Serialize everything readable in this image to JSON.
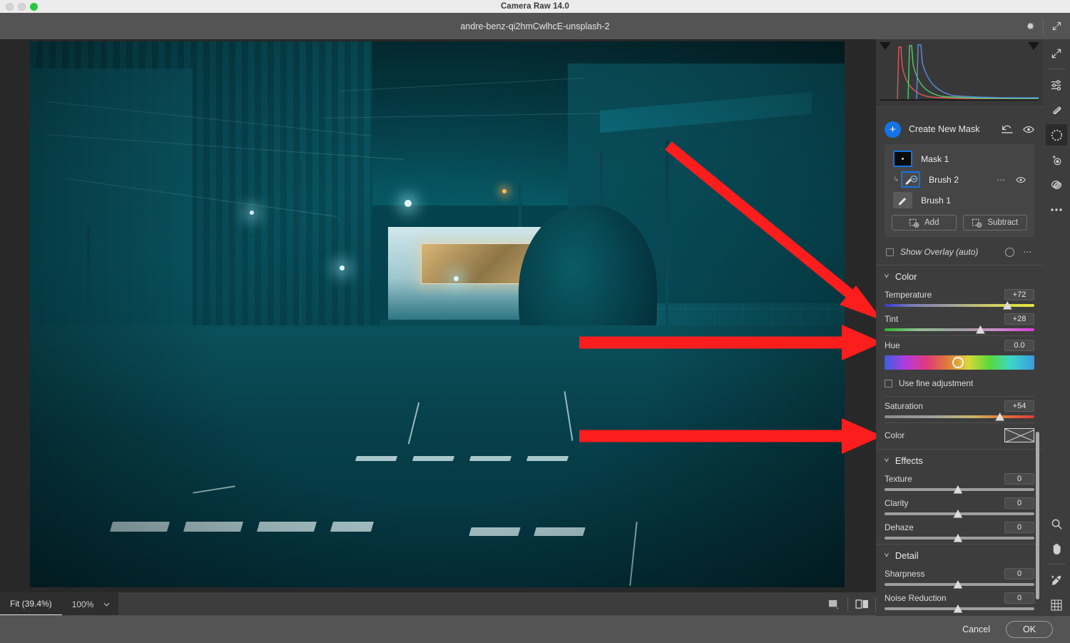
{
  "window": {
    "app_title": "Camera Raw 14.0",
    "file_name": "andre-benz-qi2hmCwlhcE-unsplash-2",
    "traffic_lights": [
      "close-disabled",
      "minimize-disabled",
      "zoom-green"
    ]
  },
  "header": {
    "settings_icon": "gear-icon",
    "fullscreen_icon": "expand-arrows-icon"
  },
  "canvas": {
    "image_alt": "night street scene in Tokyo with crosswalk, teal color grade",
    "annotations": [
      {
        "name": "arrow-to-temperature",
        "type": "diagonal-arrow",
        "color": "#fc1d1d"
      },
      {
        "name": "arrow-to-tint",
        "type": "horizontal-arrow",
        "color": "#fc1d1d"
      },
      {
        "name": "arrow-to-saturation",
        "type": "horizontal-arrow",
        "color": "#fc1d1d"
      }
    ]
  },
  "bottom_bar": {
    "fit_label": "Fit (39.4%)",
    "zoom_label": "100%",
    "caret_icon": "chevron-down-icon",
    "toggle_icon": "before-after-single-icon",
    "compare_icon": "before-after-split-icon"
  },
  "footer": {
    "cancel_label": "Cancel",
    "ok_label": "OK"
  },
  "right_panel": {
    "histogram": {
      "name": "histogram",
      "shadow_clip_icon": "shadow-clipping-triangle",
      "highlight_clip_icon": "highlight-clipping-triangle",
      "channels": [
        "red",
        "green",
        "blue"
      ]
    },
    "masking": {
      "create_new_mask_label": "Create New Mask",
      "plus_icon": "plus-icon",
      "reset_icon": "reset-arrow-icon",
      "visibility_icon": "eye-icon",
      "accent_color": "#1473e6",
      "masks": [
        {
          "name": "Mask 1",
          "thumb": "mask-thumbnail",
          "selected": true,
          "indent": 0
        },
        {
          "name": "Brush 2",
          "thumb": "brush-subtract-icon",
          "selected": true,
          "indent": 1,
          "more_icon": "ellipsis-icon",
          "eye_icon": "eye-icon"
        },
        {
          "name": "Brush 1",
          "thumb": "brush-icon",
          "selected": false,
          "indent": 0
        }
      ],
      "add_label": "Add",
      "subtract_label": "Subtract",
      "add_icon": "add-mask-icon",
      "subtract_icon": "subtract-mask-icon"
    },
    "overlay": {
      "label": "Show Overlay (auto)",
      "checked": false,
      "color_ring_icon": "overlay-color-icon",
      "more_icon": "ellipsis-icon"
    },
    "sections": [
      {
        "id": "color",
        "title": "Color",
        "expanded": true,
        "chevron_icon": "chevron-down-icon",
        "sliders": [
          {
            "label": "Temperature",
            "value": "+72",
            "percent": 82,
            "track": "temp"
          },
          {
            "label": "Tint",
            "value": "+28",
            "percent": 64,
            "track": "tint"
          }
        ],
        "hue": {
          "label": "Hue",
          "value": "0.0",
          "percent": 49
        },
        "fine_adjustment": {
          "label": "Use fine adjustment",
          "checked": false
        },
        "saturation": {
          "label": "Saturation",
          "value": "+54",
          "percent": 77,
          "track": "sat"
        },
        "color_swatch": {
          "label": "Color",
          "swatch": "empty-color-swatch"
        }
      },
      {
        "id": "effects",
        "title": "Effects",
        "expanded": true,
        "chevron_icon": "chevron-down-icon",
        "sliders": [
          {
            "label": "Texture",
            "value": "0",
            "percent": 49,
            "track": "plain"
          },
          {
            "label": "Clarity",
            "value": "0",
            "percent": 49,
            "track": "plain"
          },
          {
            "label": "Dehaze",
            "value": "0",
            "percent": 49,
            "track": "plain"
          }
        ]
      },
      {
        "id": "detail",
        "title": "Detail",
        "expanded": true,
        "chevron_icon": "chevron-down-icon",
        "sliders": [
          {
            "label": "Sharpness",
            "value": "0",
            "percent": 49,
            "track": "plain"
          },
          {
            "label": "Noise Reduction",
            "value": "0",
            "percent": 49,
            "track": "plain"
          }
        ]
      }
    ],
    "scrollbar": {
      "name": "panel-scrollbar"
    }
  },
  "tool_rail": {
    "top_tools": [
      {
        "name": "fullscreen-icon",
        "active": false
      },
      {
        "name": "edit-sliders-icon",
        "active": false
      },
      {
        "name": "healing-brush-icon",
        "active": false
      },
      {
        "name": "masking-icon",
        "active": true
      },
      {
        "name": "red-eye-icon",
        "active": false
      },
      {
        "name": "presets-icon",
        "active": false
      },
      {
        "name": "more-ellipsis-icon",
        "active": false
      }
    ],
    "bottom_tools": [
      {
        "name": "zoom-tool-icon",
        "active": false
      },
      {
        "name": "hand-tool-icon",
        "active": false
      },
      {
        "name": "white-balance-eyedropper-icon",
        "active": false
      },
      {
        "name": "grid-overlay-icon",
        "active": false
      }
    ]
  }
}
